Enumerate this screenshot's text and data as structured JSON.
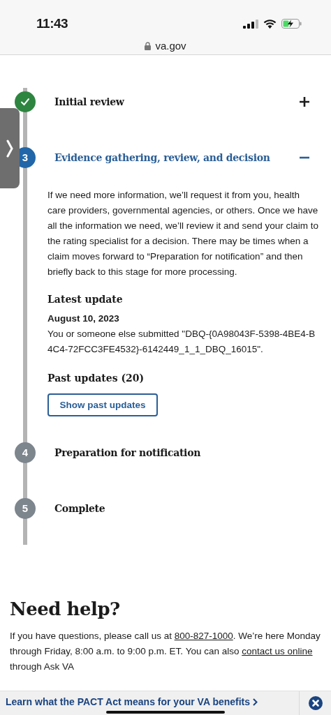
{
  "status_bar": {
    "time": "11:43"
  },
  "browser": {
    "url": "va.gov"
  },
  "steps": [
    {
      "kind": "complete",
      "title": "Initial review",
      "expanded": false
    },
    {
      "kind": "current",
      "number": "3",
      "title": "Evidence gathering, review, and decision",
      "expanded": true,
      "description": "If we need more information, we’ll request it from you, health care providers, governmental agencies, or others. Once we have all the information we need, we’ll review it and send your claim to the rating specialist for a decision. There may be times when a claim moves forward to “Preparation for notification” and then briefly back to this stage for more processing.",
      "latest_update": {
        "heading": "Latest update",
        "date": "August 10, 2023",
        "text": "You or someone else submitted \"DBQ-{0A98043F-5398-4BE4-B4C4-72FCC3FE4532}-6142449_1_1_DBQ_16015\"."
      },
      "past_updates": {
        "heading": "Past updates (20)",
        "button": "Show past updates"
      }
    },
    {
      "kind": "upcoming",
      "number": "4",
      "title": "Preparation for notification"
    },
    {
      "kind": "upcoming",
      "number": "5",
      "title": "Complete"
    }
  ],
  "help": {
    "title": "Need help?",
    "paragraph": [
      {
        "text": "If you have questions, please call us at "
      },
      {
        "text": "800-827-1000",
        "link": true
      },
      {
        "text": ". We’re here Monday through Friday, 8:00 a.m. to 9:00 p.m. ET. You can also "
      },
      {
        "text": "contact us online",
        "link": true
      },
      {
        "text": " through Ask VA"
      }
    ]
  },
  "banner": {
    "text": "Learn what the PACT Act means for your VA benefits"
  }
}
